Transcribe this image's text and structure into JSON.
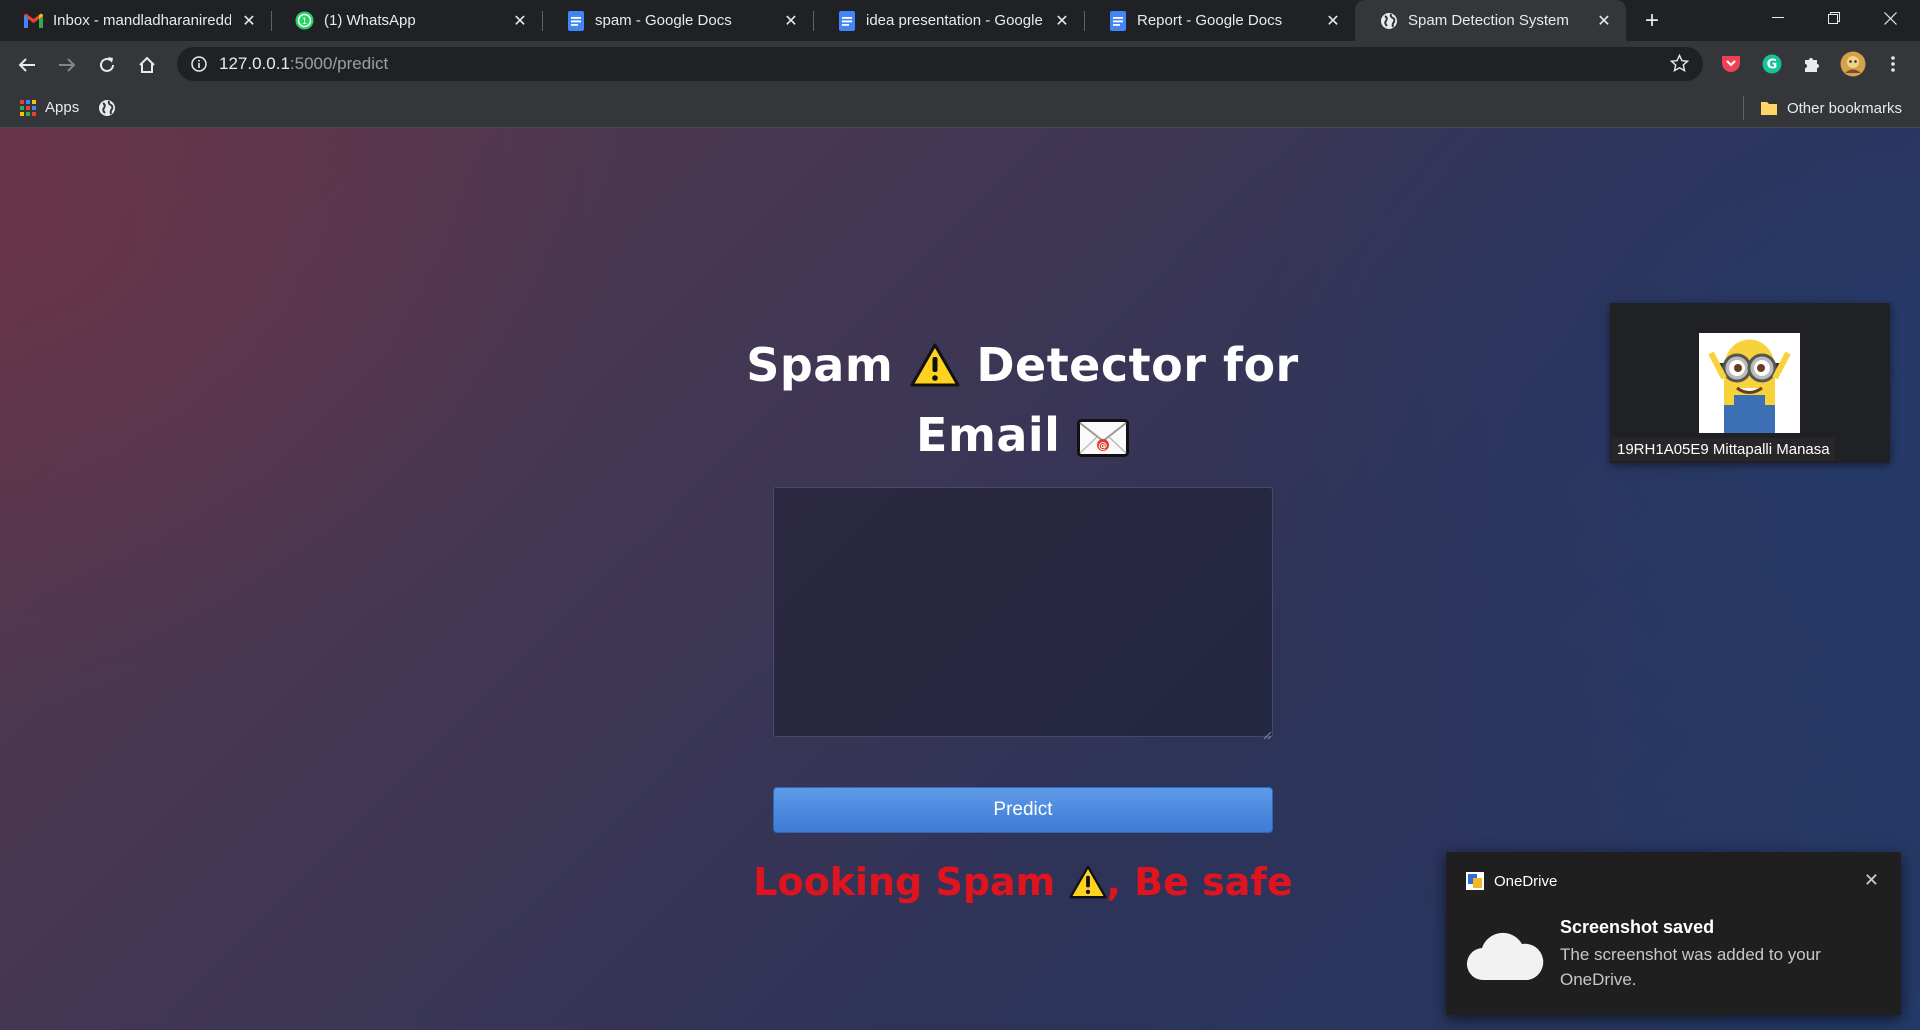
{
  "browser": {
    "tabs": [
      {
        "title": "Inbox - mandladharanireddy",
        "icon": "gmail-icon",
        "active": false
      },
      {
        "title": "(1) WhatsApp",
        "icon": "whatsapp-icon",
        "active": false
      },
      {
        "title": "spam - Google Docs",
        "icon": "docs-icon",
        "active": false
      },
      {
        "title": "idea presentation - Google Docs",
        "icon": "docs-icon",
        "active": false
      },
      {
        "title": "Report - Google Docs",
        "icon": "docs-icon",
        "active": false
      },
      {
        "title": "Spam Detection System",
        "icon": "globe-icon",
        "active": true
      }
    ],
    "new_tab_label": "+",
    "address": {
      "host": "127.0.0.1",
      "path": ":5000/predict"
    },
    "bookmarks": {
      "apps_label": "Apps",
      "other_label": "Other bookmarks"
    }
  },
  "page": {
    "heading_line1": "Spam",
    "heading_word2": "Detector for",
    "heading_line2": "Email",
    "message_value": "",
    "predict_label": "Predict",
    "result_part1": "Looking Spam",
    "result_part2": ", Be safe"
  },
  "video_overlay": {
    "participant_name": "19RH1A05E9 Mittapalli Manasa"
  },
  "toast": {
    "app_name": "OneDrive",
    "title": "Screenshot saved",
    "body": "The screenshot was added to your OneDrive."
  },
  "colors": {
    "result_red": "#e0141e",
    "button_blue": "#4a8ae0"
  }
}
